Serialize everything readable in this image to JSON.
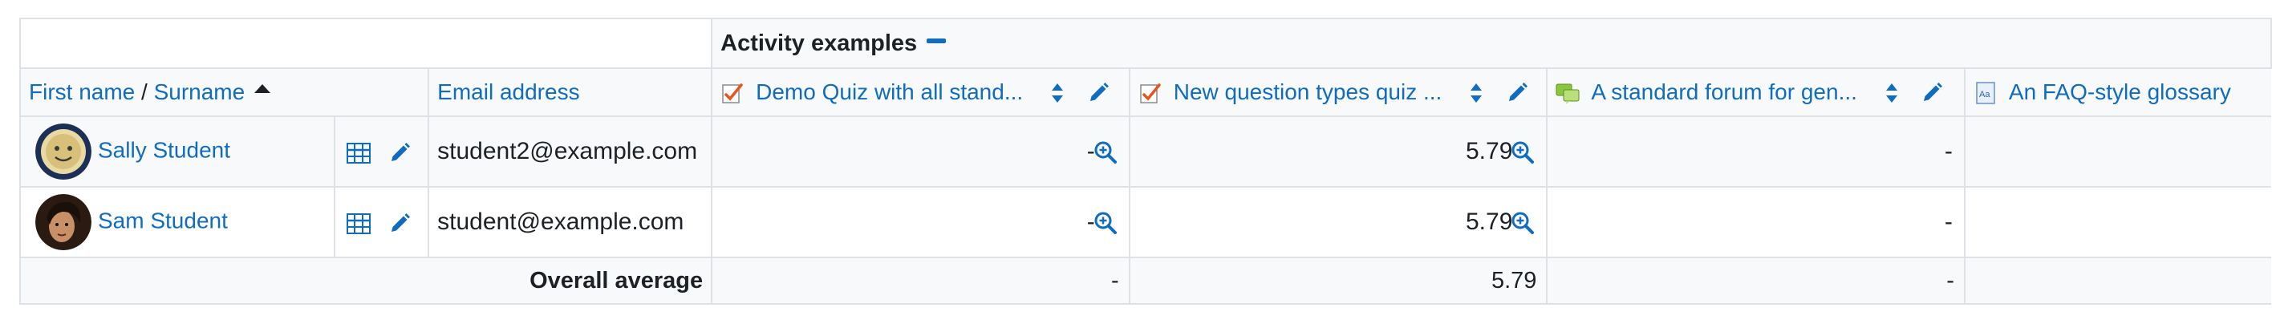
{
  "category": {
    "title": "Activity examples"
  },
  "header": {
    "first_name": "First name",
    "separator": " / ",
    "surname": "Surname",
    "email": "Email address"
  },
  "items": [
    {
      "label": "Demo Quiz with all stand...",
      "icon": "quiz-icon"
    },
    {
      "label": "New question types quiz ...",
      "icon": "quiz-icon"
    },
    {
      "label": "A standard forum for gen...",
      "icon": "forum-icon"
    },
    {
      "label": "An FAQ-style glossary",
      "icon": "glossary-icon"
    }
  ],
  "students": [
    {
      "name": "Sally Student",
      "email": "student2@example.com",
      "grades": [
        "-",
        "5.79",
        "-",
        ""
      ]
    },
    {
      "name": "Sam Student",
      "email": "student@example.com",
      "grades": [
        "-",
        "5.79",
        "-",
        ""
      ]
    }
  ],
  "footer": {
    "label": "Overall average",
    "averages": [
      "-",
      "5.79",
      "-",
      ""
    ]
  },
  "colors": {
    "link": "#0f6cbf",
    "border": "#dee2e6",
    "header_bg": "#f8f9fa"
  }
}
